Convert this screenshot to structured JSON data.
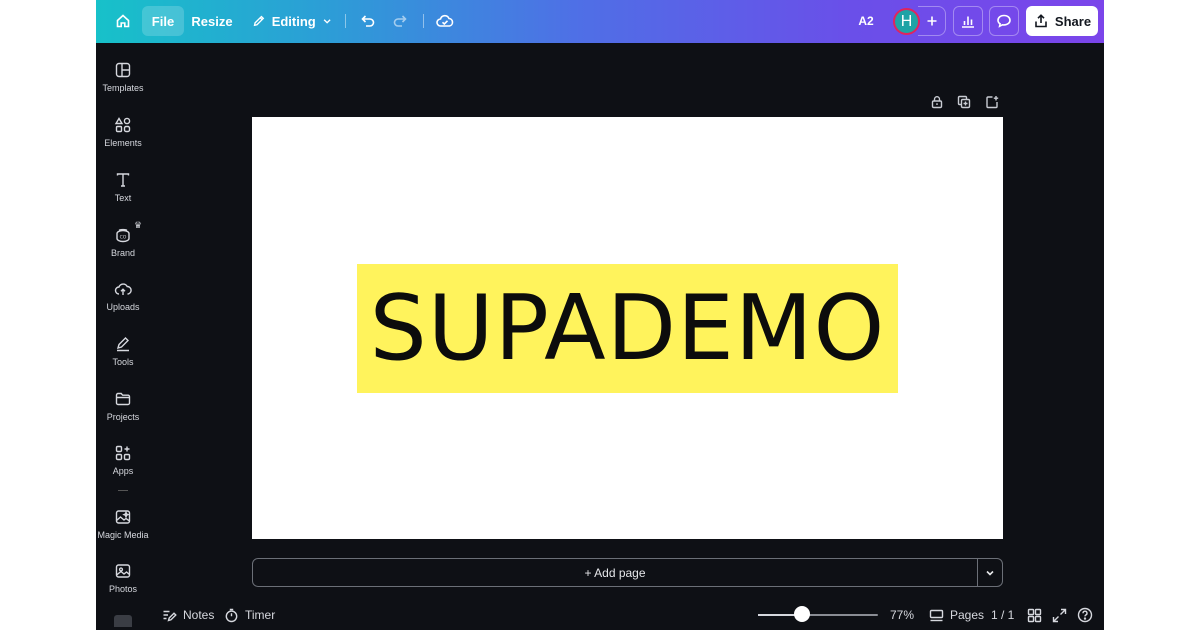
{
  "topbar": {
    "file_label": "File",
    "resize_label": "Resize",
    "editing_label": "Editing",
    "badge_label": "A2",
    "avatar_initial": "H",
    "share_label": "Share"
  },
  "sidebar": {
    "items": [
      {
        "label": "Templates",
        "icon": "templates-icon"
      },
      {
        "label": "Elements",
        "icon": "elements-icon"
      },
      {
        "label": "Text",
        "icon": "text-icon"
      },
      {
        "label": "Brand",
        "icon": "brand-icon"
      },
      {
        "label": "Uploads",
        "icon": "uploads-icon"
      },
      {
        "label": "Tools",
        "icon": "tools-icon"
      },
      {
        "label": "Projects",
        "icon": "projects-icon"
      },
      {
        "label": "Apps",
        "icon": "apps-icon"
      },
      {
        "label": "Magic Media",
        "icon": "magic-media-icon"
      },
      {
        "label": "Photos",
        "icon": "photos-icon"
      }
    ]
  },
  "canvas": {
    "headline": "SUPADEMO",
    "highlight_color": "#fff35c",
    "add_page_label": "+ Add page"
  },
  "bottombar": {
    "notes_label": "Notes",
    "timer_label": "Timer",
    "zoom_value": 0.77,
    "zoom_label": "77%",
    "pages_label": "Pages",
    "page_count": "1 / 1"
  },
  "colors": {
    "workspace_bg": "#0e1015",
    "gradient_start": "#17c1c9",
    "gradient_end": "#7b45ea",
    "avatar_bg": "#1fa3a6"
  }
}
